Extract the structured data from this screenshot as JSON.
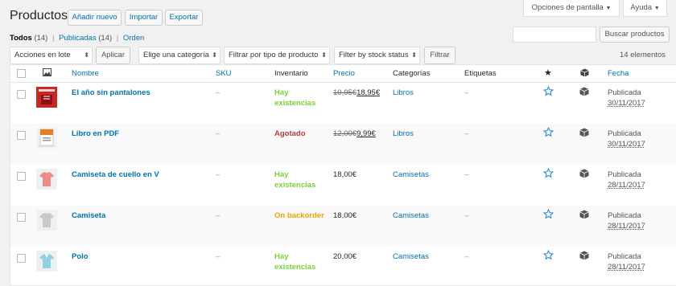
{
  "page": {
    "title": "Productos",
    "add_new": "Añadir nuevo",
    "import": "Importar",
    "export": "Exportar",
    "screen_options": "Opciones de pantalla",
    "help": "Ayuda"
  },
  "views": {
    "all": "Todos",
    "all_count": "(14)",
    "published": "Publicadas",
    "published_count": "(14)",
    "sort": "Orden",
    "sep": "|"
  },
  "search": {
    "value": "",
    "button": "Buscar productos"
  },
  "filters": {
    "bulk_actions": "Acciones en lote",
    "apply": "Aplicar",
    "category": "Elige una categoría",
    "product_type": "Filtrar por tipo de producto",
    "stock_status": "Filter by stock status",
    "filter": "Filtrar",
    "item_count": "14 elementos"
  },
  "columns": {
    "name": "Nombre",
    "sku": "SKU",
    "stock": "Inventario",
    "price": "Precio",
    "categories": "Categorías",
    "tags": "Etiquetas",
    "date": "Fecha"
  },
  "products": [
    {
      "name": "El año sin pantalones",
      "sku": "–",
      "stock_line1": "Hay",
      "stock_line2": "existencias",
      "stock_status": "instock",
      "price_old": "10,95€",
      "price_new": "18,95€",
      "price": "",
      "category": "Libros",
      "tags": "–",
      "status": "Publicada",
      "date": "30/11/2017",
      "thumb": "book-red"
    },
    {
      "name": "Libro en PDF",
      "sku": "–",
      "stock_line1": "Agotado",
      "stock_line2": "",
      "stock_status": "outofstock",
      "price_old": "12,00€",
      "price_new": "9,99€",
      "price": "",
      "category": "Libros",
      "tags": "–",
      "status": "Publicada",
      "date": "30/11/2017",
      "thumb": "pdf"
    },
    {
      "name": "Camiseta de cuello en V",
      "sku": "–",
      "stock_line1": "Hay",
      "stock_line2": "existencias",
      "stock_status": "instock",
      "price_old": "",
      "price_new": "",
      "price": "18,00€",
      "category": "Camisetas",
      "tags": "–",
      "status": "Publicada",
      "date": "28/11/2017",
      "thumb": "shirt-pink"
    },
    {
      "name": "Camiseta",
      "sku": "–",
      "stock_line1": "On backorder",
      "stock_line2": "",
      "stock_status": "backorder",
      "price_old": "",
      "price_new": "",
      "price": "18,00€",
      "category": "Camisetas",
      "tags": "–",
      "status": "Publicada",
      "date": "28/11/2017",
      "thumb": "shirt-gray"
    },
    {
      "name": "Polo",
      "sku": "–",
      "stock_line1": "Hay",
      "stock_line2": "existencias",
      "stock_status": "instock",
      "price_old": "",
      "price_new": "",
      "price": "20,00€",
      "category": "Camisetas",
      "tags": "–",
      "status": "Publicada",
      "date": "28/11/2017",
      "thumb": "shirt-blue"
    }
  ],
  "colors": {
    "link": "#0073aa",
    "instock": "#7ad03a",
    "outofstock": "#aa4444",
    "backorder": "#eaa600"
  }
}
